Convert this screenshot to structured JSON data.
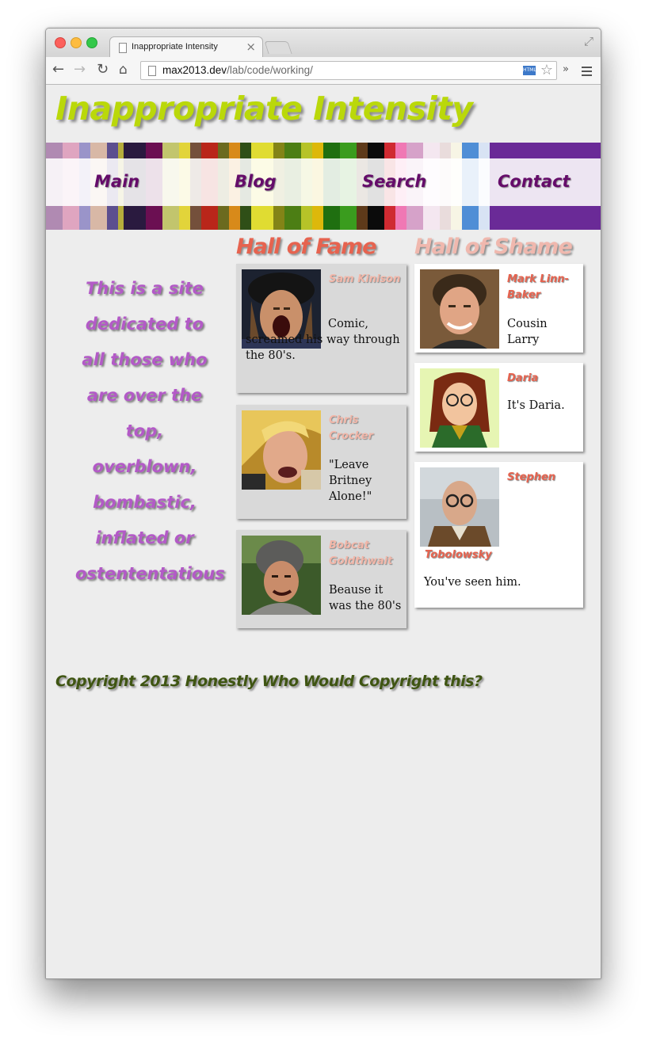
{
  "browser": {
    "tab_title": "Inappropriate Intensity",
    "tab_close": "×",
    "url_host": "max2013.dev",
    "url_path": "/lab/code/working/",
    "html_badge": "HTML",
    "icons": [
      "back-arrow-icon",
      "forward-arrow-icon",
      "reload-icon",
      "home-icon",
      "page-icon",
      "star-icon",
      "chevrons-icon",
      "menu-icon",
      "expand-icon"
    ]
  },
  "site": {
    "title": "Inappropriate Intensity",
    "title_color": "#bad80a"
  },
  "nav": {
    "items": [
      {
        "label": "Main"
      },
      {
        "label": "Blog"
      },
      {
        "label": "Search"
      },
      {
        "label": "Contact"
      }
    ],
    "color": "#650c6a"
  },
  "intro": {
    "text": "This is a site dedicated to all those who are over the top, overblown, bombastic, inflated or ostententatious",
    "color": "#b35ac7"
  },
  "hall_of_fame": {
    "heading": "Hall of Fame",
    "heading_color": "#e6634f",
    "cards": [
      {
        "name": "Sam Kinison",
        "desc": "Comic, screamed his way through the 80's."
      },
      {
        "name": "Chris Crocker",
        "desc": "\"Leave Britney Alone!\""
      },
      {
        "name": "Bobcat Goldthwait",
        "desc": "Beause it was the 80's"
      }
    ]
  },
  "hall_of_shame": {
    "heading": "Hall of Shame",
    "heading_color": "#f0b8ae",
    "cards": [
      {
        "name": "Mark Linn-Baker",
        "desc": "Cousin Larry"
      },
      {
        "name": "Daria",
        "desc": "It's Daria."
      },
      {
        "name": "Stephen Tobolowsky",
        "name_line1": "Stephen",
        "name_line2": "Tobolowsky",
        "desc": "You've seen him."
      }
    ]
  },
  "footer": {
    "text": "Copyright 2013 Honestly Who Would Copyright this?",
    "color": "#3f5512"
  }
}
